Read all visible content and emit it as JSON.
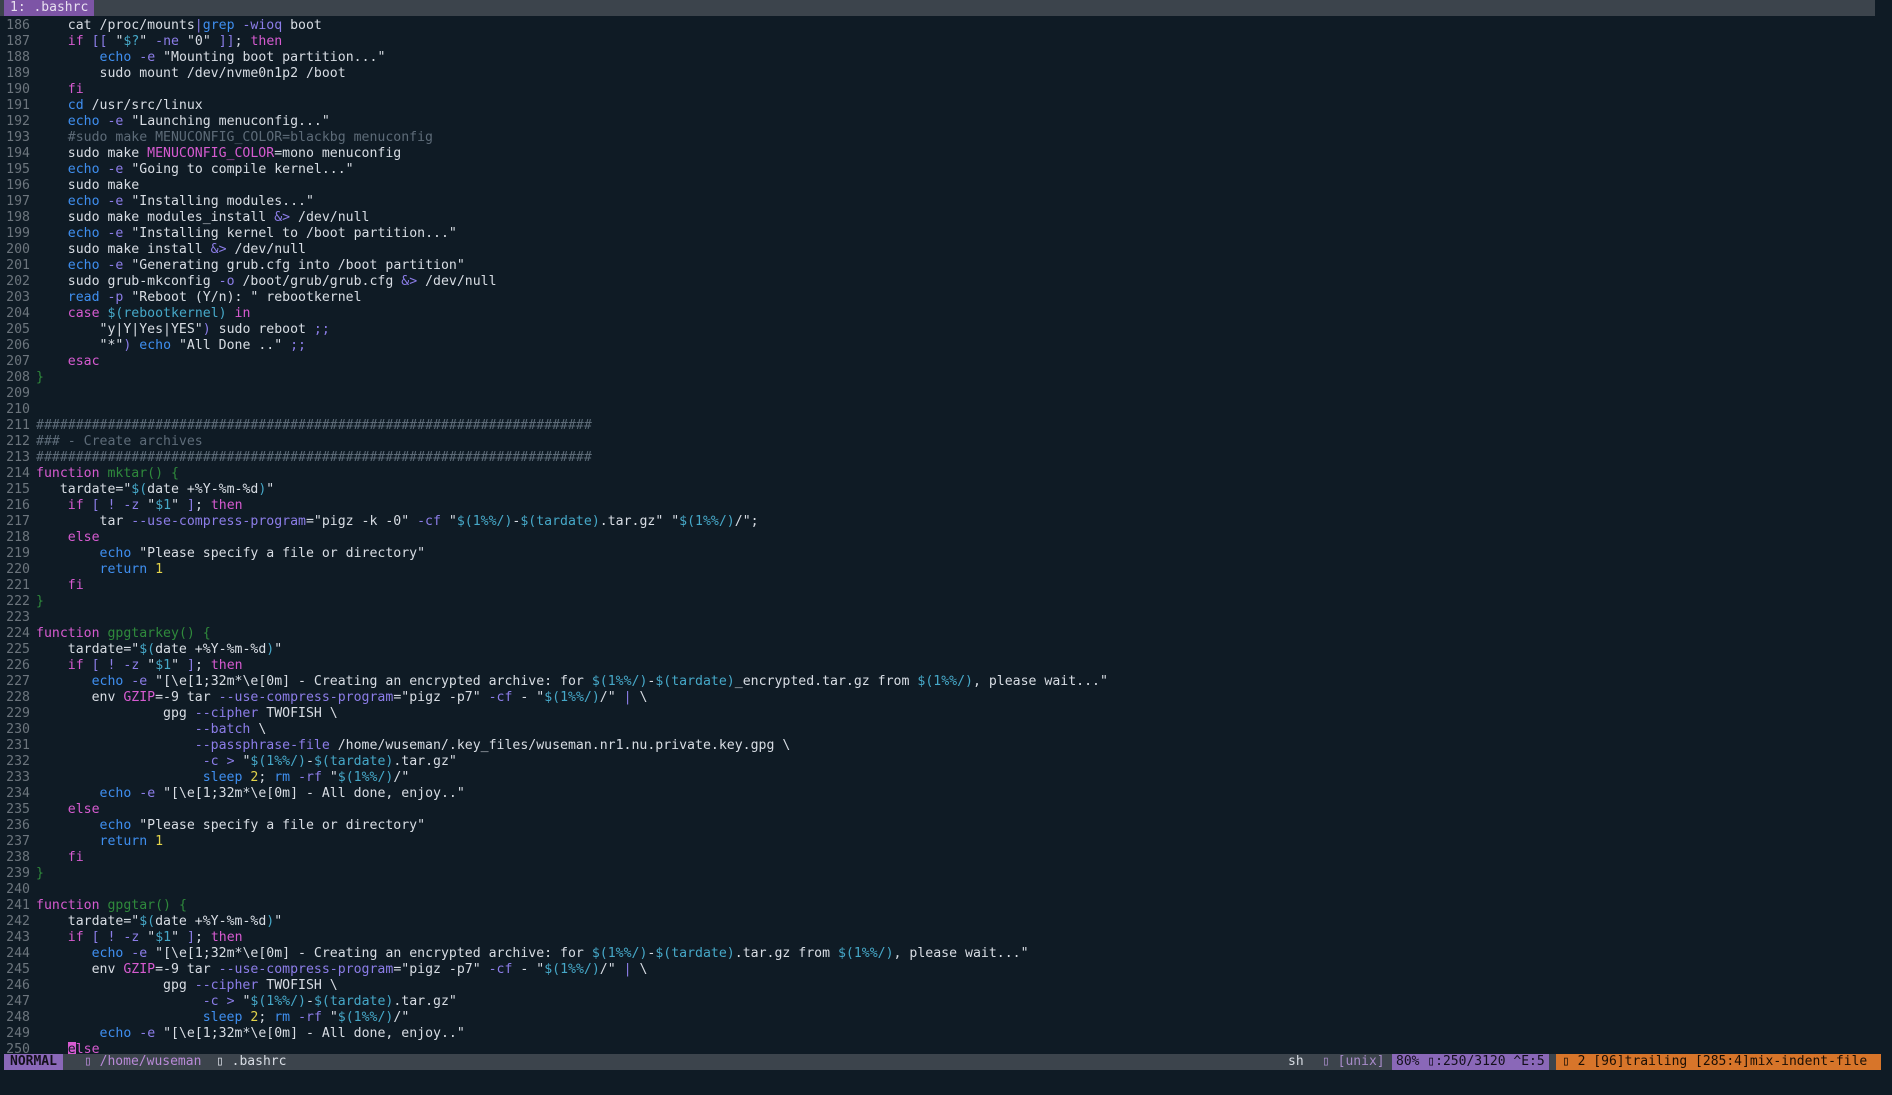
{
  "tabline": {
    "tab_label": "1: .bashrc"
  },
  "editor": {
    "lines": [
      {
        "n": "186",
        "html": "    cat /proc/mounts<span class=\"o\">|</span><span class=\"b\">grep</span> <span class=\"o\">-wioq</span> boot"
      },
      {
        "n": "187",
        "html": "    <span class=\"k\">if</span> <span class=\"o\">[[</span> \"<span class=\"v\">$?</span>\" <span class=\"o\">-ne</span> \"0\" <span class=\"o\">]]</span>; <span class=\"k\">then</span>"
      },
      {
        "n": "188",
        "html": "        <span class=\"b\">echo</span> <span class=\"o\">-e</span> \"Mounting boot partition...\""
      },
      {
        "n": "189",
        "html": "        sudo mount /dev/nvme0n1p2 /boot"
      },
      {
        "n": "190",
        "html": "    <span class=\"k\">fi</span>"
      },
      {
        "n": "191",
        "html": "    <span class=\"b\">cd</span> /usr/src/linux"
      },
      {
        "n": "192",
        "html": "    <span class=\"b\">echo</span> <span class=\"o\">-e</span> \"Launching menuconfig...\""
      },
      {
        "n": "193",
        "html": "    <span class=\"c\">#sudo make MENUCONFIG_COLOR=blackbg menuconfig</span>"
      },
      {
        "n": "194",
        "html": "    sudo make <span class=\"k\">MENUCONFIG_COLOR</span>=mono menuconfig"
      },
      {
        "n": "195",
        "html": "    <span class=\"b\">echo</span> <span class=\"o\">-e</span> \"Going to compile kernel...\""
      },
      {
        "n": "196",
        "html": "    sudo make"
      },
      {
        "n": "197",
        "html": "    <span class=\"b\">echo</span> <span class=\"o\">-e</span> \"Installing modules...\""
      },
      {
        "n": "198",
        "html": "    sudo make modules_install <span class=\"o\">&amp;&gt;</span> /dev/null"
      },
      {
        "n": "199",
        "html": "    <span class=\"b\">echo</span> <span class=\"o\">-e</span> \"Installing kernel to /boot partition...\""
      },
      {
        "n": "200",
        "html": "    sudo make install <span class=\"o\">&amp;&gt;</span> /dev/null"
      },
      {
        "n": "201",
        "html": "    <span class=\"b\">echo</span> <span class=\"o\">-e</span> \"Generating grub.cfg into /boot partition\""
      },
      {
        "n": "202",
        "html": "    sudo grub-mkconfig <span class=\"o\">-o</span> /boot/grub/grub.cfg <span class=\"o\">&amp;&gt;</span> /dev/null"
      },
      {
        "n": "203",
        "html": "    <span class=\"b\">read</span> <span class=\"o\">-p</span> \"Reboot (Y/n): \" rebootkernel"
      },
      {
        "n": "204",
        "html": "    <span class=\"k\">case</span> <span class=\"v\">$(rebootkernel)</span> <span class=\"k\">in</span>"
      },
      {
        "n": "205",
        "html": "        \"y|Y|Yes|YES\"<span class=\"o\">)</span> sudo reboot <span class=\"o\">;;</span>"
      },
      {
        "n": "206",
        "html": "        \"*\"<span class=\"o\">)</span> <span class=\"b\">echo</span> \"All Done ..\" <span class=\"o\">;;</span>"
      },
      {
        "n": "207",
        "html": "    <span class=\"k\">esac</span>"
      },
      {
        "n": "208",
        "html": "<span class=\"f\">}</span>"
      },
      {
        "n": "209",
        "html": ""
      },
      {
        "n": "210",
        "html": ""
      },
      {
        "n": "211",
        "html": "<span class=\"c\">######################################################################</span>"
      },
      {
        "n": "212",
        "html": "<span class=\"c\">### - Create archives</span>"
      },
      {
        "n": "213",
        "html": "<span class=\"c\">######################################################################</span>"
      },
      {
        "n": "214",
        "html": "<span class=\"k\">function</span> <span class=\"f\">mktar() {</span>"
      },
      {
        "n": "215",
        "html": "   tardate=\"<span class=\"v\">$(</span>date +%Y-%m-%d<span class=\"v\">)</span>\""
      },
      {
        "n": "216",
        "html": "    <span class=\"k\">if</span> <span class=\"o\">[</span> <span class=\"o\">!</span> <span class=\"o\">-z</span> \"<span class=\"v\">$1</span>\" <span class=\"o\">]</span>; <span class=\"k\">then</span>"
      },
      {
        "n": "217",
        "html": "        tar <span class=\"o\">--use-compress-program</span>=\"pigz -k -0\" <span class=\"o\">-cf</span> \"<span class=\"v\">$(1%%/)</span>-<span class=\"v\">$(tardate)</span>.tar.gz\" \"<span class=\"v\">$(1%%/)</span>/\";"
      },
      {
        "n": "218",
        "html": "    <span class=\"k\">else</span>"
      },
      {
        "n": "219",
        "html": "        <span class=\"b\">echo</span> \"Please specify a file or directory\""
      },
      {
        "n": "220",
        "html": "        <span class=\"b\">return</span> <span class=\"n\">1</span>"
      },
      {
        "n": "221",
        "html": "    <span class=\"k\">fi</span>"
      },
      {
        "n": "222",
        "html": "<span class=\"f\">}</span>"
      },
      {
        "n": "223",
        "html": ""
      },
      {
        "n": "224",
        "html": "<span class=\"k\">function</span> <span class=\"f\">gpgtarkey() {</span>"
      },
      {
        "n": "225",
        "html": "    tardate=\"<span class=\"v\">$(</span>date +%Y-%m-%d<span class=\"v\">)</span>\""
      },
      {
        "n": "226",
        "html": "    <span class=\"k\">if</span> <span class=\"o\">[</span> <span class=\"o\">!</span> <span class=\"o\">-z</span> \"<span class=\"v\">$1</span>\" <span class=\"o\">]</span>; <span class=\"k\">then</span>"
      },
      {
        "n": "227",
        "html": "       <span class=\"b\">echo</span> <span class=\"o\">-e</span> \"[\\e[1;32m*\\e[0m] - Creating an encrypted archive: for <span class=\"v\">$(1%%/)</span>-<span class=\"v\">$(tardate)</span>_encrypted.tar.gz from <span class=\"v\">$(1%%/)</span>, please wait...\""
      },
      {
        "n": "228",
        "html": "       env <span class=\"k\">GZIP</span>=-9 tar <span class=\"o\">--use-compress-program</span>=\"pigz -p7\" <span class=\"o\">-cf</span> - \"<span class=\"v\">$(1%%/)</span>/\" <span class=\"o\">|</span> \\"
      },
      {
        "n": "229",
        "html": "                gpg <span class=\"o\">--cipher</span> TWOFISH \\"
      },
      {
        "n": "230",
        "html": "                    <span class=\"o\">--batch</span> \\"
      },
      {
        "n": "231",
        "html": "                    <span class=\"o\">--passphrase-file</span> /home/wuseman/.key_files/wuseman.nr1.nu.private.key.gpg \\"
      },
      {
        "n": "232",
        "html": "                     <span class=\"o\">-c</span> <span class=\"o\">&gt;</span> \"<span class=\"v\">$(1%%/)</span>-<span class=\"v\">$(tardate)</span>.tar.gz\""
      },
      {
        "n": "233",
        "html": "                     <span class=\"b\">sleep</span> <span class=\"n\">2</span>; <span class=\"b\">rm</span> <span class=\"o\">-rf</span> \"<span class=\"v\">$(1%%/)</span>/\""
      },
      {
        "n": "234",
        "html": "        <span class=\"b\">echo</span> <span class=\"o\">-e</span> \"[\\e[1;32m*\\e[0m] - All done, enjoy..\""
      },
      {
        "n": "235",
        "html": "    <span class=\"k\">else</span>"
      },
      {
        "n": "236",
        "html": "        <span class=\"b\">echo</span> \"Please specify a file or directory\""
      },
      {
        "n": "237",
        "html": "        <span class=\"b\">return</span> <span class=\"n\">1</span>"
      },
      {
        "n": "238",
        "html": "    <span class=\"k\">fi</span>"
      },
      {
        "n": "239",
        "html": "<span class=\"f\">}</span>"
      },
      {
        "n": "240",
        "html": ""
      },
      {
        "n": "241",
        "html": "<span class=\"k\">function</span> <span class=\"f\">gpgtar() {</span>"
      },
      {
        "n": "242",
        "html": "    tardate=\"<span class=\"v\">$(</span>date +%Y-%m-%d<span class=\"v\">)</span>\""
      },
      {
        "n": "243",
        "html": "    <span class=\"k\">if</span> <span class=\"o\">[</span> <span class=\"o\">!</span> <span class=\"o\">-z</span> \"<span class=\"v\">$1</span>\" <span class=\"o\">]</span>; <span class=\"k\">then</span>"
      },
      {
        "n": "244",
        "html": "       <span class=\"b\">echo</span> <span class=\"o\">-e</span> \"[\\e[1;32m*\\e[0m] - Creating an encrypted archive: for <span class=\"v\">$(1%%/)</span>-<span class=\"v\">$(tardate)</span>.tar.gz from <span class=\"v\">$(1%%/)</span>, please wait...\""
      },
      {
        "n": "245",
        "html": "       env <span class=\"k\">GZIP</span>=-9 tar <span class=\"o\">--use-compress-program</span>=\"pigz -p7\" <span class=\"o\">-cf</span> - \"<span class=\"v\">$(1%%/)</span>/\" <span class=\"o\">|</span> \\"
      },
      {
        "n": "246",
        "html": "                gpg <span class=\"o\">--cipher</span> TWOFISH \\"
      },
      {
        "n": "247",
        "html": "                     <span class=\"o\">-c</span> <span class=\"o\">&gt;</span> \"<span class=\"v\">$(1%%/)</span>-<span class=\"v\">$(tardate)</span>.tar.gz\""
      },
      {
        "n": "248",
        "html": "                     <span class=\"b\">sleep</span> <span class=\"n\">2</span>; <span class=\"b\">rm</span> <span class=\"o\">-rf</span> \"<span class=\"v\">$(1%%/)</span>/\""
      },
      {
        "n": "249",
        "html": "        <span class=\"b\">echo</span> <span class=\"o\">-e</span> \"[\\e[1;32m*\\e[0m] - All done, enjoy..\""
      },
      {
        "n": "250",
        "html": "    <span class=\"cursor\">e</span><span class=\"k\">lse</span>"
      }
    ]
  },
  "statusline": {
    "mode": "NORMAL",
    "path": "▯ /home/wuseman",
    "file": "▯ .bashrc",
    "filetype": "sh",
    "fileformat": "▯ [unix] ▯",
    "position": "80% ▯:250/3120 ^E:5",
    "warnings": "▯ 2 [96]trailing [285:4]mix-indent-file"
  },
  "colors": {
    "background": "#0f1b25",
    "keyword": "#d65bd0",
    "builtin": "#3f8ff0",
    "variable": "#46a8c8",
    "comment": "#5d6b78",
    "function": "#2f8a3c",
    "number": "#e3d34a",
    "mode_bg": "#8a68b8",
    "warning_bg": "#d7752a"
  }
}
